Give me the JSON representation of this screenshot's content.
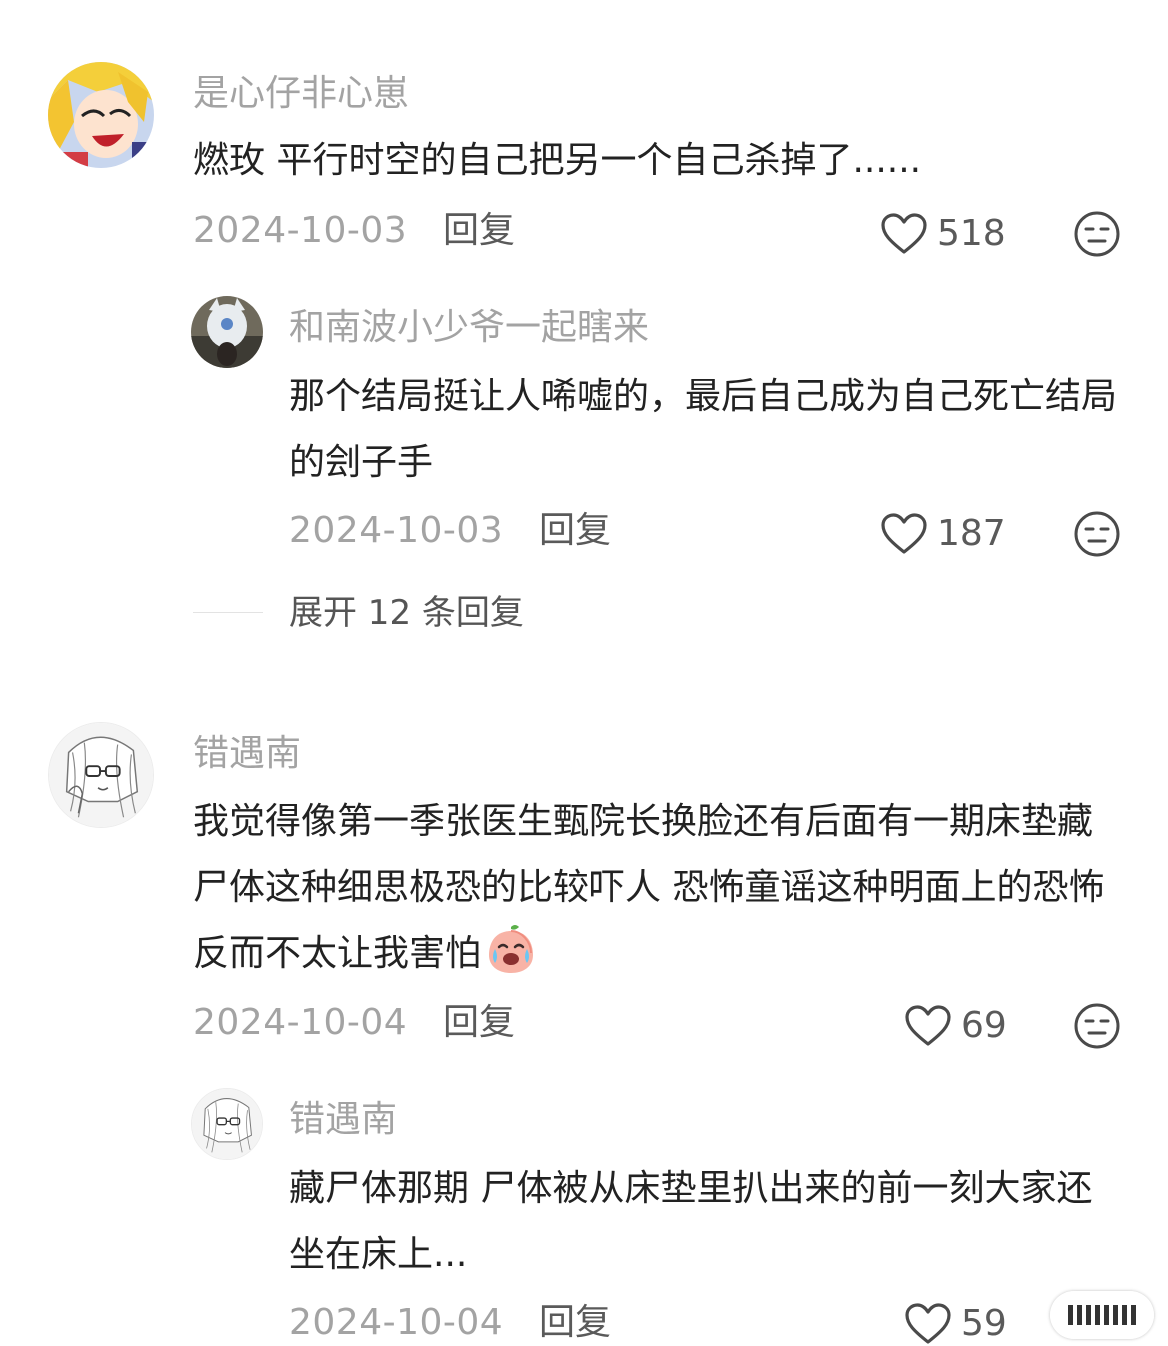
{
  "comments": [
    {
      "username": "是心仔非心崽",
      "text": "燃玫 平行时空的自己把另一个自己杀掉了......",
      "date": "2024-10-03",
      "reply_label": "回复",
      "likes": "518",
      "replies": [
        {
          "username": "和南波小少爷一起瞎来",
          "text": "那个结局挺让人唏嘘的，最后自己成为自己死亡结局的刽子手",
          "date": "2024-10-03",
          "reply_label": "回复",
          "likes": "187"
        }
      ],
      "expand_label": "展开 12 条回复"
    },
    {
      "username": "错遇南",
      "text": "我觉得像第一季张医生甄院长换脸还有后面有一期床垫藏尸体这种细思极恐的比较吓人 恐怖童谣这种明面上的恐怖反而不太让我害怕",
      "emoji": "crying-peach-emoji",
      "date": "2024-10-04",
      "reply_label": "回复",
      "likes": "69",
      "replies": [
        {
          "username": "错遇南",
          "text": "藏尸体那期 尸体被从床垫里扒出来的前一刻大家还坐在床上...",
          "date": "2024-10-04",
          "reply_label": "回复",
          "likes": "59"
        }
      ]
    }
  ],
  "icons": {
    "like": "heart-outline-icon",
    "dislike": "neutral-face-icon",
    "watermark": "weibo-watermark-icon"
  },
  "colors": {
    "username": "#a3a3a3",
    "text": "#222222",
    "meta": "#5a5a5a",
    "icon": "#4a4a4a"
  }
}
